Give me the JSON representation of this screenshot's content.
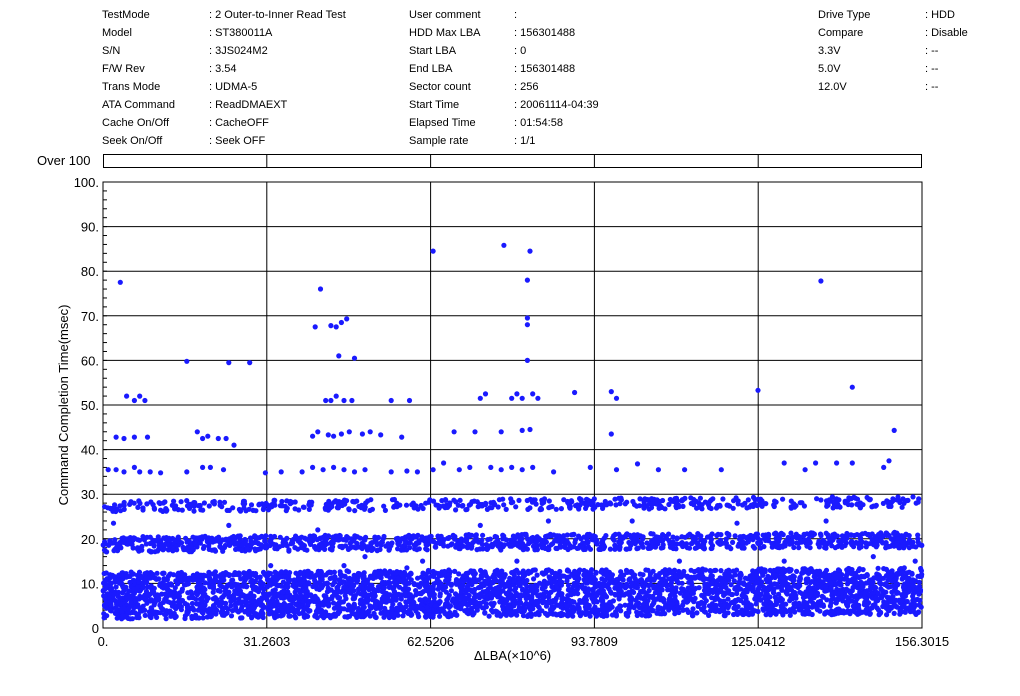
{
  "info": {
    "col1": [
      {
        "label": "TestMode",
        "value": ": 2 Outer-to-Inner Read Test"
      },
      {
        "label": "Model",
        "value": ": ST380011A"
      },
      {
        "label": "S/N",
        "value": ": 3JS024M2"
      },
      {
        "label": "F/W Rev",
        "value": ": 3.54"
      },
      {
        "label": "Trans Mode",
        "value": ": UDMA-5"
      },
      {
        "label": "ATA Command",
        "value": ": ReadDMAEXT"
      },
      {
        "label": "Cache On/Off",
        "value": ": CacheOFF"
      },
      {
        "label": "Seek On/Off",
        "value": ": Seek OFF"
      }
    ],
    "col2": [
      {
        "label": "User comment",
        "value": ":"
      },
      {
        "label": "HDD Max LBA",
        "value": ": 156301488"
      },
      {
        "label": "Start LBA",
        "value": ": 0"
      },
      {
        "label": "End LBA",
        "value": ": 156301488"
      },
      {
        "label": "Sector count",
        "value": ": 256"
      },
      {
        "label": "Start Time",
        "value": ": 20061114-04:39"
      },
      {
        "label": "Elapsed Time",
        "value": ": 01:54:58"
      },
      {
        "label": "Sample rate",
        "value": ": 1/1"
      }
    ],
    "col3": [
      {
        "label": "Drive Type",
        "value": ": HDD"
      },
      {
        "label": "Compare",
        "value": ": Disable"
      },
      {
        "label": "3.3V",
        "value": ": --"
      },
      {
        "label": "5.0V",
        "value": ": --"
      },
      {
        "label": "12.0V",
        "value": ": --"
      }
    ]
  },
  "over_label": "Over 100",
  "colors": {
    "points": "#1a1aff",
    "axis": "#000000"
  },
  "chart_data": {
    "type": "scatter",
    "title": "",
    "xlabel": "ΔLBA(×10^6)",
    "ylabel": "Command Completion Time(msec)",
    "xlim": [
      0,
      156.3015
    ],
    "ylim": [
      0,
      100
    ],
    "x_tick_labels": [
      "0.",
      "31.2603",
      "62.5206",
      "93.7809",
      "125.0412",
      "156.3015"
    ],
    "x_ticks": [
      0,
      31.2603,
      62.5206,
      93.7809,
      125.0412,
      156.3015
    ],
    "y_tick_labels": [
      "0",
      "10.",
      "20.",
      "30.",
      "40.",
      "50.",
      "60.",
      "70.",
      "80.",
      "90.",
      "100."
    ],
    "y_ticks": [
      0,
      10,
      20,
      30,
      40,
      50,
      60,
      70,
      80,
      90,
      100
    ],
    "grid": true,
    "series": [
      {
        "name": "",
        "points": [
          [
            3.3,
            77.5
          ],
          [
            18,
            44
          ],
          [
            16,
            59.8
          ],
          [
            24,
            59.5
          ],
          [
            25,
            41
          ],
          [
            28,
            59.5
          ],
          [
            4.5,
            52
          ],
          [
            6,
            51
          ],
          [
            7,
            52
          ],
          [
            8,
            51
          ],
          [
            2.5,
            42.8
          ],
          [
            4,
            42.5
          ],
          [
            6,
            42.8
          ],
          [
            8.5,
            42.8
          ],
          [
            19,
            42.5
          ],
          [
            20,
            43
          ],
          [
            22,
            42.5
          ],
          [
            23.5,
            42.5
          ],
          [
            40.5,
            67.5
          ],
          [
            41.5,
            76
          ],
          [
            43.5,
            67.8
          ],
          [
            44.5,
            67.5
          ],
          [
            45.5,
            68.5
          ],
          [
            46.5,
            69.3
          ],
          [
            45,
            61
          ],
          [
            48,
            60.5
          ],
          [
            40,
            43
          ],
          [
            41,
            44
          ],
          [
            42.5,
            51
          ],
          [
            43.5,
            51
          ],
          [
            44.5,
            52
          ],
          [
            46,
            51
          ],
          [
            47.5,
            51
          ],
          [
            43,
            43.3
          ],
          [
            44,
            43
          ],
          [
            45.5,
            43.5
          ],
          [
            47,
            44
          ],
          [
            49.5,
            43.5
          ],
          [
            51,
            44
          ],
          [
            53,
            43.3
          ],
          [
            55,
            51
          ],
          [
            57,
            42.8
          ],
          [
            58.5,
            51
          ],
          [
            63,
            84.5
          ],
          [
            76.5,
            85.8
          ],
          [
            81.5,
            84.5
          ],
          [
            81,
            78
          ],
          [
            81,
            69.5
          ],
          [
            81,
            68
          ],
          [
            81,
            60
          ],
          [
            72,
            51.5
          ],
          [
            73,
            52.5
          ],
          [
            76,
            44
          ],
          [
            78,
            51.5
          ],
          [
            79,
            52.5
          ],
          [
            80,
            51.5
          ],
          [
            82,
            52.5
          ],
          [
            83,
            51.5
          ],
          [
            90,
            52.8
          ],
          [
            97,
            53
          ],
          [
            98,
            51.5
          ],
          [
            67,
            44
          ],
          [
            71,
            44
          ],
          [
            80,
            44.3
          ],
          [
            81.5,
            44.5
          ],
          [
            97,
            43.5
          ],
          [
            137,
            77.8
          ],
          [
            125,
            53.3
          ],
          [
            143,
            54
          ],
          [
            150,
            37.5
          ],
          [
            151,
            44.3
          ],
          [
            1,
            35.5
          ],
          [
            2.5,
            35.5
          ],
          [
            4,
            35
          ],
          [
            6,
            36
          ],
          [
            7,
            35
          ],
          [
            9,
            35
          ],
          [
            11,
            34.8
          ],
          [
            16,
            35
          ],
          [
            19,
            36
          ],
          [
            20.5,
            36
          ],
          [
            23,
            35.5
          ],
          [
            31,
            34.8
          ],
          [
            34,
            35
          ],
          [
            38,
            35
          ],
          [
            40,
            36
          ],
          [
            42,
            35.5
          ],
          [
            44,
            36
          ],
          [
            46,
            35.5
          ],
          [
            48,
            35
          ],
          [
            50,
            35.5
          ],
          [
            55,
            35
          ],
          [
            58,
            35.2
          ],
          [
            60,
            35
          ],
          [
            63,
            35.5
          ],
          [
            65,
            37
          ],
          [
            68,
            35.5
          ],
          [
            70,
            36
          ],
          [
            74,
            36
          ],
          [
            76,
            35.5
          ],
          [
            78,
            36
          ],
          [
            80,
            35.5
          ],
          [
            82,
            36
          ],
          [
            86,
            35
          ],
          [
            93,
            36
          ],
          [
            98,
            35.5
          ],
          [
            102,
            36.8
          ],
          [
            106,
            35.5
          ],
          [
            111,
            35.5
          ],
          [
            118,
            35.5
          ],
          [
            130,
            37
          ],
          [
            134,
            35.5
          ],
          [
            136,
            37
          ],
          [
            140,
            37
          ],
          [
            143,
            37
          ],
          [
            149,
            36
          ]
        ],
        "bands": [
          {
            "y_min": 26,
            "y_max": 28.5,
            "density": 0.55
          },
          {
            "y_min": 17,
            "y_max": 20.5,
            "density": 0.95
          },
          {
            "y_min": 2,
            "y_max": 12.5,
            "density": 1
          }
        ],
        "sparse_scatter": [
          [
            2,
            23.5
          ],
          [
            24,
            23
          ],
          [
            32,
            14
          ],
          [
            41,
            22
          ],
          [
            46,
            14
          ],
          [
            50,
            16
          ],
          [
            58,
            13.5
          ],
          [
            61,
            15
          ],
          [
            66,
            13
          ],
          [
            72,
            23
          ],
          [
            79,
            15
          ],
          [
            85,
            24
          ],
          [
            91,
            13
          ],
          [
            101,
            24
          ],
          [
            110,
            15
          ],
          [
            115,
            13
          ],
          [
            121,
            23.5
          ],
          [
            130,
            15
          ],
          [
            138,
            24
          ],
          [
            147,
            16
          ],
          [
            155,
            15
          ]
        ]
      }
    ]
  }
}
